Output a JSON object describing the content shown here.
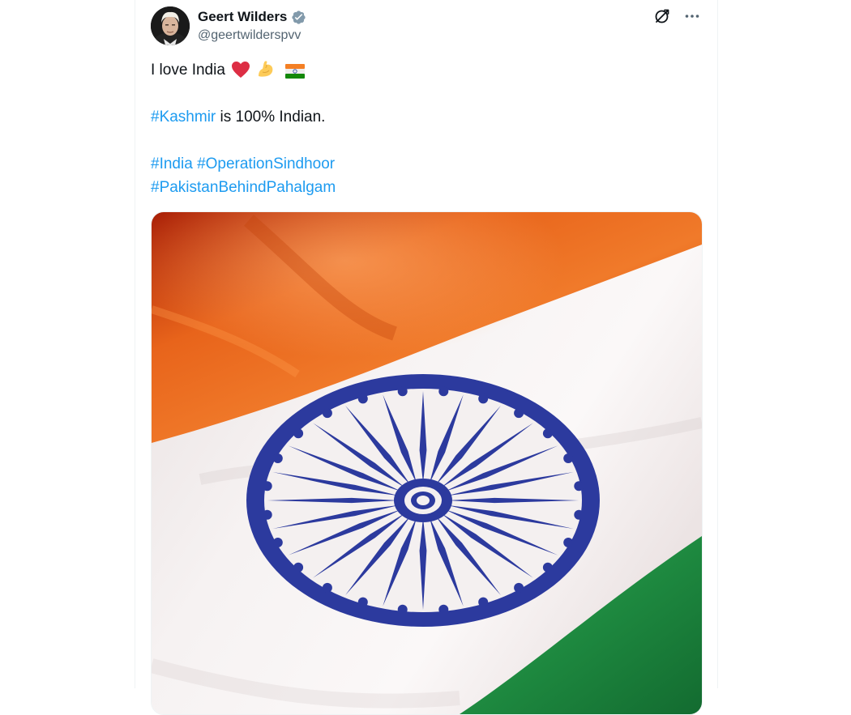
{
  "author": {
    "display_name": "Geert Wilders",
    "handle": "@geertwilderspvv",
    "verified": true
  },
  "tweet": {
    "line1_text": "I love India",
    "line1_emojis": [
      "red-heart",
      "flexed-biceps",
      "india-flag"
    ],
    "line2_hashtag": "#Kashmir",
    "line2_rest": " is 100% Indian.",
    "hashtags_line3": [
      "#India",
      "#OperationSindhoor"
    ],
    "hashtags_line4": [
      "#PakistanBehindPahalgam"
    ]
  },
  "media": {
    "image_subject": "Indian national flag"
  },
  "actions": {
    "grok_icon": "grok-icon",
    "more_icon": "more-icon"
  },
  "colors": {
    "link": "#1d9bf0",
    "text": "#0f1419",
    "secondary": "#536471",
    "saffron": "#e8641b",
    "green": "#1e7a38",
    "chakra_blue": "#2c3a9e"
  }
}
